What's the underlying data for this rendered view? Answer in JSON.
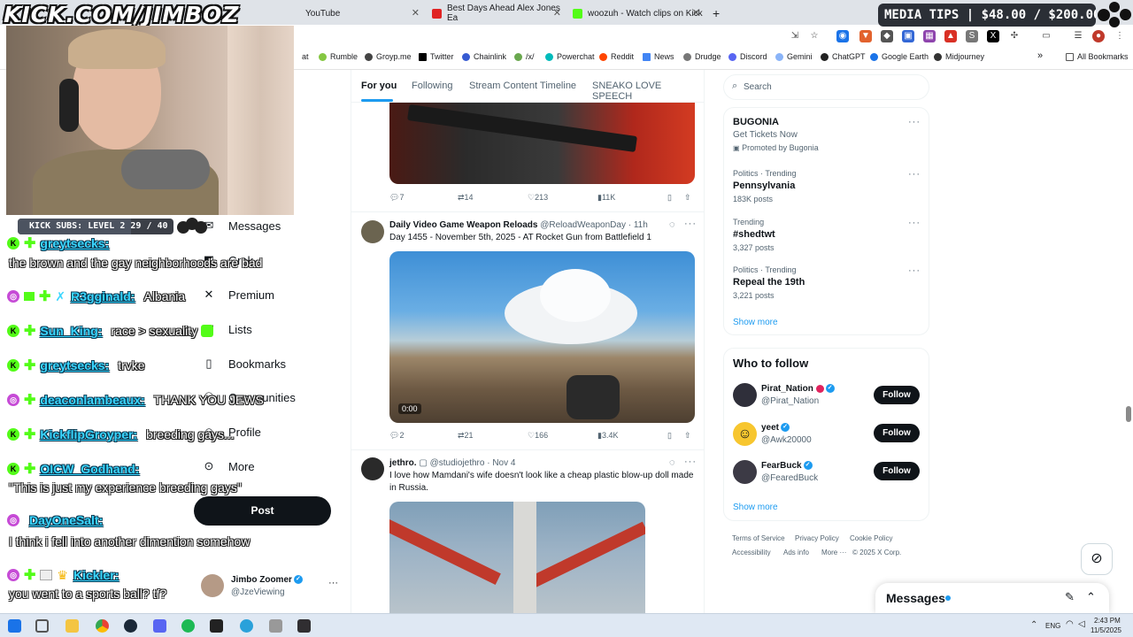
{
  "stream_overlay": {
    "url_banner": "KICK.COM/JIMBOZ",
    "media_tips": "MEDIA TIPS | $48.00 / $200.00",
    "kick_subs": "KICK SUBS: LEVEL 2 29 / 40",
    "kick_subs_progress": 0.725
  },
  "browser": {
    "tabs": [
      {
        "title": "YouTube",
        "color": "#ff0000"
      },
      {
        "title": "Best Days Ahead Alex Jones Ea",
        "color": "#e02424"
      },
      {
        "title": "woozuh - Watch clips on Kick",
        "color": "#53fc18"
      }
    ],
    "new_tab": "+",
    "bookmarks": [
      "at",
      "Rumble",
      "Groyp.me",
      "Twitter",
      "Chainlink",
      "/x/",
      "Powerchat",
      "Reddit",
      "News",
      "Drudge",
      "Discord",
      "Gemini",
      "ChatGPT",
      "Google Earth",
      "Midjourney"
    ],
    "all_bookmarks": "All Bookmarks",
    "more_chevron": "»"
  },
  "feed_tabs": [
    "For you",
    "Following",
    "Stream Content Timeline",
    "SNEAKO LOVE SPEECH"
  ],
  "left_nav": {
    "items": [
      "Messages",
      "Grok",
      "Premium",
      "Lists",
      "Bookmarks",
      "Communities",
      "Profile",
      "More"
    ],
    "post_button": "Post",
    "account_name": "Jimbo Zoomer",
    "account_handle": "@JzeViewing"
  },
  "posts": [
    {
      "stats": {
        "replies": "7",
        "reposts": "14",
        "likes": "213",
        "views": "11K"
      }
    },
    {
      "name": "Daily Video Game Weapon Reloads",
      "handle": "@ReloadWeaponDay",
      "time": "· 11h",
      "text": "Day 1455 - November 5th, 2025 - AT Rocket Gun from Battlefield 1",
      "video_time": "0:00",
      "stats": {
        "replies": "2",
        "reposts": "21",
        "likes": "166",
        "views": "3.4K"
      }
    },
    {
      "name": "jethro.",
      "handle": "@studiojethro",
      "time": "· Nov 4",
      "text": "I love how Mamdani's wife doesn't look like a cheap plastic blow-up doll made in Russia."
    }
  ],
  "sidebar": {
    "search_placeholder": "Search",
    "ad": {
      "title": "BUGONIA",
      "subtitle": "Get Tickets Now",
      "promoted": "Promoted by Bugonia"
    },
    "trends": [
      {
        "meta": "Politics · Trending",
        "title": "Pennsylvania",
        "posts": "183K posts"
      },
      {
        "meta": "Trending",
        "title": "#shedtwt",
        "posts": "3,327 posts"
      },
      {
        "meta": "Politics · Trending",
        "title": "Repeal the 19th",
        "posts": "3,221 posts"
      }
    ],
    "show_more": "Show more",
    "who_to_follow_title": "Who to follow",
    "who_to_follow": [
      {
        "name": "Pirat_Nation",
        "handle": "@Pirat_Nation"
      },
      {
        "name": "yeet",
        "handle": "@Awk20000"
      },
      {
        "name": "FearBuck",
        "handle": "@FearedBuck"
      }
    ],
    "follow_label": "Follow",
    "footer": [
      "Terms of Service",
      "Privacy Policy",
      "Cookie Policy",
      "Accessibility",
      "Ads info",
      "More ···",
      "© 2025 X Corp."
    ],
    "messages_drawer": "Messages"
  },
  "chat": [
    {
      "user": "greytsecks:",
      "msg": ""
    },
    {
      "line": "the brown and the gay neighborhoods are bad"
    },
    {
      "user": "R3gginald:",
      "msg": "Albania"
    },
    {
      "user": "Sun_King:",
      "msg": "race > sexuality"
    },
    {
      "user": "greytsecks:",
      "msg": "trvke"
    },
    {
      "user": "deaconlambeaux:",
      "msg": "THANK YOU JEWS"
    },
    {
      "user": "KickflipGroyper:",
      "msg": "breeding gays..."
    },
    {
      "user": "OICW_Godhand:",
      "msg": ""
    },
    {
      "line": "\"This is just my experience breeding gays\""
    },
    {
      "user": "DayOneSalt:",
      "msg": ""
    },
    {
      "line": "I think i fell into another dimention somehow"
    },
    {
      "user": "Kickler:",
      "msg": ""
    },
    {
      "line": "you went to a sports ball? tf?"
    }
  ],
  "taskbar": {
    "lang": "ENG",
    "time": "2:43 PM",
    "date": "11/5/2025"
  }
}
